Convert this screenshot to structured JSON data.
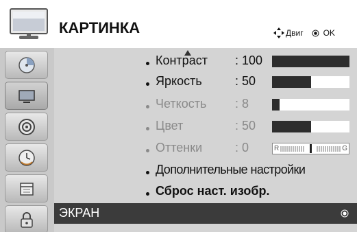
{
  "header": {
    "title": "КАРТИНКА",
    "nav_label": "Двиг",
    "ok_label": "OK"
  },
  "sidebar": {
    "items": [
      {
        "name": "picture-menu-1",
        "icon": "disc-pie-icon"
      },
      {
        "name": "tv-screen",
        "icon": "tv-icon"
      },
      {
        "name": "audio",
        "icon": "speaker-icon"
      },
      {
        "name": "time",
        "icon": "clock-icon"
      },
      {
        "name": "options",
        "icon": "calendar-icon"
      },
      {
        "name": "lock",
        "icon": "lock-icon"
      }
    ],
    "active_index": 1
  },
  "settings": [
    {
      "label": "Контраст",
      "value": ": 100",
      "level": 1.0,
      "dim": false
    },
    {
      "label": "Яркость",
      "value": ": 50",
      "level": 0.5,
      "dim": false
    },
    {
      "label": "Четкость",
      "value": ": 8",
      "level": 0.1,
      "dim": true
    },
    {
      "label": "Цвет",
      "value": ": 50",
      "level": 0.5,
      "dim": true
    },
    {
      "label": "Оттенки",
      "value": ": 0",
      "tint_left": "R",
      "tint_right": "G",
      "dim": true
    }
  ],
  "more_settings": "Дополнительные настройки",
  "reset": "Сброс наст. изобр.",
  "screen_item": "ЭКРАН",
  "colors": {
    "sidebar_bg": "#c9c9c9",
    "panel_bg": "#d4d4d4",
    "bar_fill": "#2d2d2d",
    "selected_row": "#3b3b3b"
  }
}
